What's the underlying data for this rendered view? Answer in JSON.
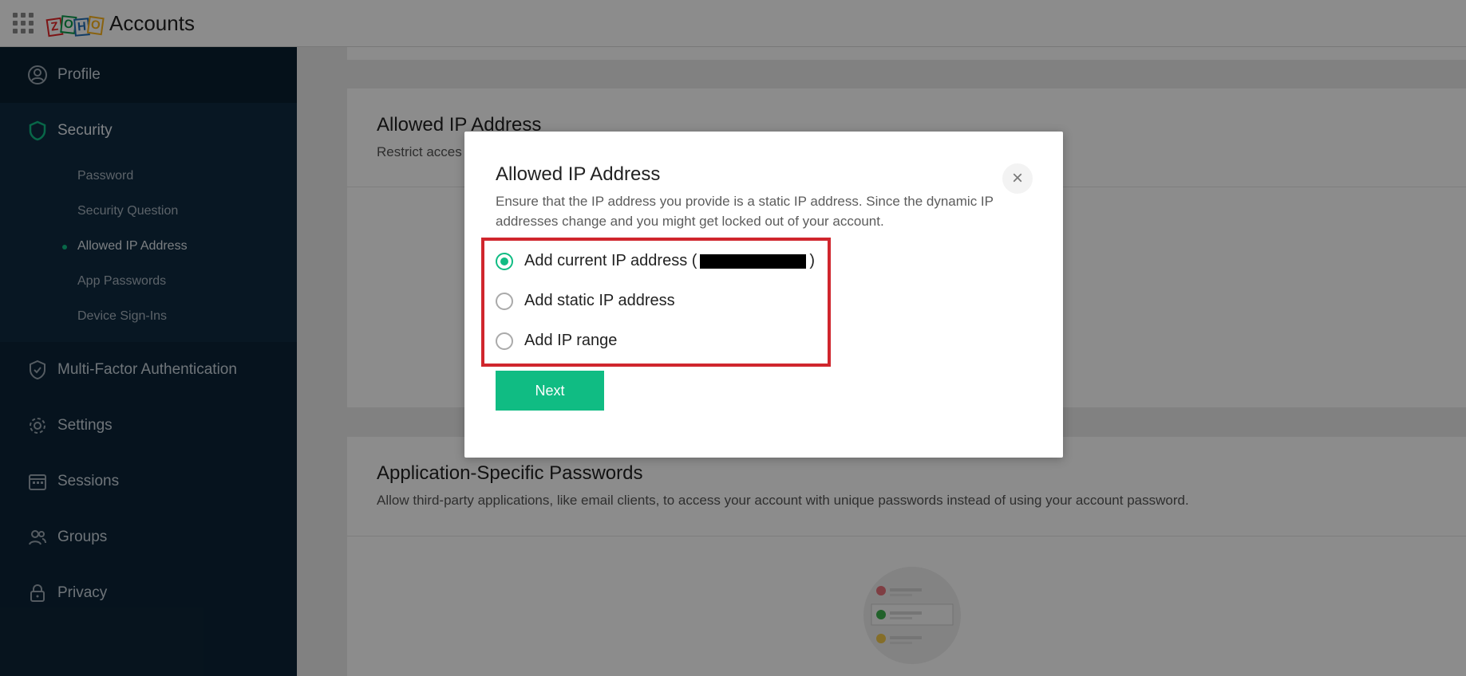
{
  "header": {
    "app_title": "Accounts",
    "logo_letters": [
      "Z",
      "O",
      "H",
      "O"
    ]
  },
  "sidebar": {
    "items": [
      {
        "label": "Profile",
        "icon": "user-circle-icon"
      },
      {
        "label": "Security",
        "icon": "shield-icon",
        "active": true
      },
      {
        "label": "Multi-Factor Authentication",
        "icon": "shield-check-icon"
      },
      {
        "label": "Settings",
        "icon": "gear-icon"
      },
      {
        "label": "Sessions",
        "icon": "calendar-icon"
      },
      {
        "label": "Groups",
        "icon": "users-icon"
      },
      {
        "label": "Privacy",
        "icon": "lock-icon"
      }
    ],
    "security_sub": [
      {
        "label": "Password"
      },
      {
        "label": "Security Question"
      },
      {
        "label": "Allowed IP Address",
        "active": true
      },
      {
        "label": "App Passwords"
      },
      {
        "label": "Device Sign-Ins"
      }
    ]
  },
  "main": {
    "allowed_ip": {
      "title": "Allowed IP Address",
      "desc_partial": "Restrict acces"
    },
    "app_passwords": {
      "title": "Application-Specific Passwords",
      "desc": "Allow third-party applications, like email clients, to access your account with unique passwords instead of using your account password."
    }
  },
  "modal": {
    "title": "Allowed IP Address",
    "description": "Ensure that the IP address you provide is a static IP address. Since the dynamic IP addresses change and you might get locked out of your account.",
    "options": [
      {
        "label_prefix": "Add current IP address (",
        "label_suffix": ")",
        "checked": true
      },
      {
        "label": "Add static IP address",
        "checked": false
      },
      {
        "label": "Add IP range",
        "checked": false
      }
    ],
    "next_label": "Next",
    "close_symbol": "×"
  },
  "colors": {
    "accent": "#10bc83",
    "sidebar_bg": "#0c2437",
    "highlight": "#d0262d"
  }
}
